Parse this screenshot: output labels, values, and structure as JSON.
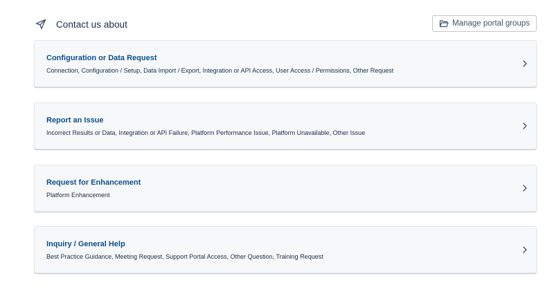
{
  "header": {
    "title": "Contact us about",
    "title_icon": "send-icon",
    "manage_button": {
      "label": "Manage portal groups",
      "icon": "folder-icon"
    }
  },
  "request_types": [
    {
      "title": "Configuration or Data Request",
      "description": "Connection, Configuration / Setup, Data Import / Export, Integration or API Access, User Access / Permissions, Other Request"
    },
    {
      "title": "Report an Issue",
      "description": "Incorrect Results or Data, Integration or API Failure, Platform Performance Issue, Platform Unavailable, Other Issue"
    },
    {
      "title": "Request for Enhancement",
      "description": "Platform Enhancement"
    },
    {
      "title": "Inquiry / General Help",
      "description": "Best Practice Guidance, Meeting Request, Support Portal Access, Other Question, Training Request"
    }
  ],
  "colors": {
    "card_title": "#0c4f8c",
    "card_background": "#f7f8f9",
    "text": "#172b4d"
  }
}
